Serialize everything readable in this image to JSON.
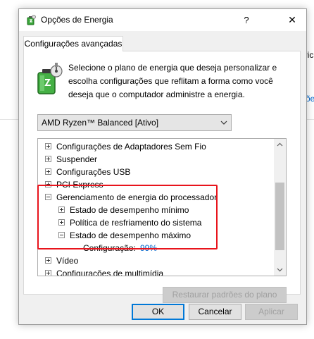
{
  "background": {
    "right_fragments": [
      "o:",
      "ivic",
      "ções"
    ]
  },
  "window": {
    "title": "Opções de Energia",
    "help_label": "?",
    "close_label": "✕"
  },
  "tab": {
    "label": "Configurações avançadas"
  },
  "description": "Selecione o plano de energia que deseja personalizar e escolha configurações que reflitam a forma como você deseja que o computador administre a energia.",
  "plan_select": {
    "value": "AMD Ryzen™ Balanced [Ativo]"
  },
  "tree": {
    "items": [
      {
        "label": "Configurações de Adaptadores Sem Fio",
        "expander": "plus"
      },
      {
        "label": "Suspender",
        "expander": "plus"
      },
      {
        "label": "Configurações USB",
        "expander": "plus"
      },
      {
        "label": "PCI Express",
        "expander": "plus"
      },
      {
        "label": "Gerenciamento de energia do processador",
        "expander": "minus"
      },
      {
        "label": "Estado de desempenho mínimo",
        "expander": "plus"
      },
      {
        "label": "Política de resfriamento do sistema",
        "expander": "plus"
      },
      {
        "label": "Estado de desempenho máximo",
        "expander": "minus"
      },
      {
        "label": "Vídeo",
        "expander": "plus"
      },
      {
        "label": "Configurações de multimídia",
        "expander": "plus"
      }
    ],
    "setting": {
      "label": "Configuração:",
      "value": "99%"
    }
  },
  "buttons": {
    "restore": "Restaurar padrões do plano",
    "ok": "OK",
    "cancel": "Cancelar",
    "apply": "Aplicar"
  },
  "colors": {
    "highlight_border": "#e8141c",
    "link_blue": "#0066cc",
    "dialog_bg": "#f0f0f0"
  }
}
